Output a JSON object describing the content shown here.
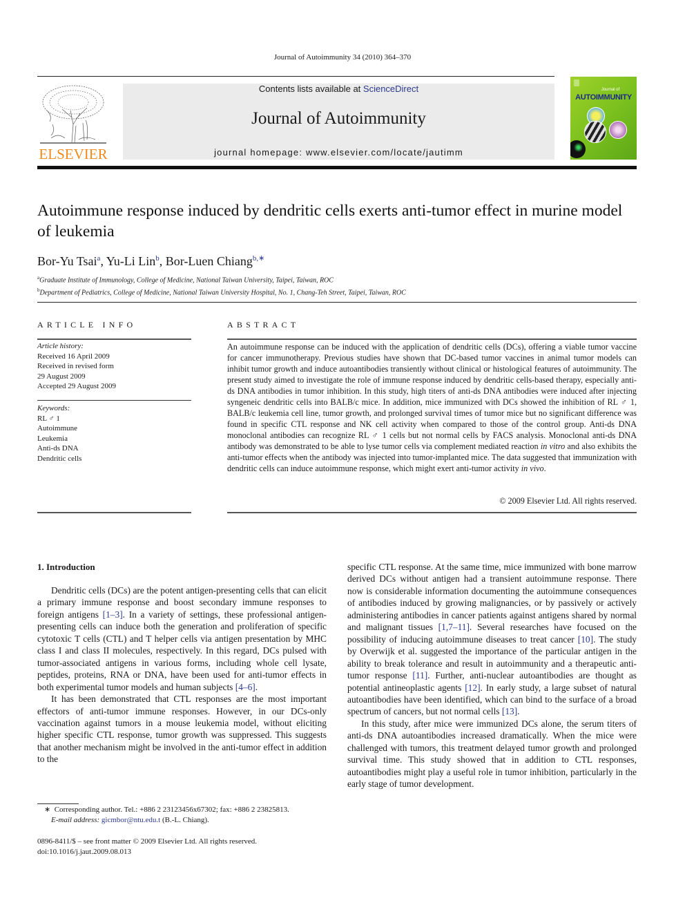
{
  "running_head": "Journal of Autoimmunity 34 (2010) 364–370",
  "publisher": {
    "logo_icon": "elsevier-tree-icon",
    "name": "ELSEVIER",
    "brand_color": "#f08a1c"
  },
  "masthead": {
    "contents_prefix": "Contents lists available at ",
    "contents_link": "ScienceDirect",
    "journal_name": "Journal of Autoimmunity",
    "homepage": "journal homepage: www.elsevier.com/locate/jautimm",
    "background": "#ebebeb"
  },
  "cover": {
    "small_label": "Journal of",
    "title": "AUTOIMMUNITY",
    "color": "#8cc824"
  },
  "article": {
    "title": "Autoimmune response induced by dendritic cells exerts anti-tumor effect in murine model of leukemia",
    "authors": [
      {
        "name": "Bor-Yu Tsai",
        "aff": "a",
        "sep": ", "
      },
      {
        "name": "Yu-Li Lin",
        "aff": "b",
        "sep": ", "
      },
      {
        "name": "Bor-Luen Chiang",
        "aff": "b,∗",
        "sep": ""
      }
    ],
    "affiliations": [
      {
        "key": "a",
        "text": "Graduate Institute of Immunology, College of Medicine, National Taiwan University, Taipei, Taiwan, ROC"
      },
      {
        "key": "b",
        "text": "Department of Pediatrics, College of Medicine, National Taiwan University Hospital, No. 1, Chang-Teh Street, Taipei, Taiwan, ROC"
      }
    ]
  },
  "article_info": {
    "heading": "ARTICLE INFO",
    "history_label": "Article history:",
    "history": [
      "Received 16 April 2009",
      "Received in revised form",
      "29 August 2009",
      "Accepted 29 August 2009"
    ],
    "keywords_label": "Keywords:",
    "keywords": [
      "RL ♂ 1",
      "Autoimmune",
      "Leukemia",
      "Anti-ds DNA",
      "Dendritic cells"
    ]
  },
  "abstract": {
    "heading": "ABSTRACT",
    "text_1": "An autoimmune response can be induced with the application of dendritic cells (DCs), offering a viable tumor vaccine for cancer immunotherapy. Previous studies have shown that DC-based tumor vaccines in animal tumor models can inhibit tumor growth and induce autoantibodies transiently without clinical or histological features of autoimmunity. The present study aimed to investigate the role of immune response induced by dendritic cells-based therapy, especially anti-ds DNA antibodies in tumor inhibition. In this study, high titers of anti-ds DNA antibodies were induced after injecting syngeneic dendritic cells into BALB/c mice. In addition, mice immunized with DCs showed the inhibition of RL ♂ 1, BALB/c leukemia cell line, tumor growth, and prolonged survival times of tumor mice but no significant difference was found in specific CTL response and NK cell activity when compared to those of the control group. Anti-ds DNA monoclonal antibodies can recognize RL ♂ 1 cells but not normal cells by FACS analysis. Monoclonal anti-ds DNA antibody was demonstrated to be able to lyse tumor cells via complement mediated reaction ",
    "italic_1": "in vitro",
    "text_2": " and also exhibits the anti-tumor effects when the antibody was injected into tumor-implanted mice. The data suggested that immunization with dendritic cells can induce autoimmune response, which might exert anti-tumor activity ",
    "italic_2": "in vivo",
    "text_3": ".",
    "copyright": "© 2009 Elsevier Ltd. All rights reserved."
  },
  "introduction": {
    "heading": "1.  Introduction",
    "left": {
      "p1": {
        "a": "Dendritic cells (DCs) are the potent antigen-presenting cells that can elicit a primary immune response and boost secondary immune responses to foreign antigens ",
        "ref1": "[1–3]",
        "b": ". In a variety of settings, these professional antigen-presenting cells can induce both the generation and proliferation of specific cytotoxic T cells (CTL) and T helper cells via antigen presentation by MHC class I and class II molecules, respectively. In this regard, DCs pulsed with tumor-associated antigens in various forms, including whole cell lysate, peptides, proteins, RNA or DNA, have been used for anti-tumor effects in both experimental tumor models and human subjects ",
        "ref2": "[4–6]",
        "c": "."
      },
      "p2": "It has been demonstrated that CTL responses are the most important effectors of anti-tumor immune responses. However, in our DCs-only vaccination against tumors in a mouse leukemia model, without eliciting higher specific CTL response, tumor growth was suppressed. This suggests that another mechanism might be involved in the anti-tumor effect in addition to the"
    },
    "right": {
      "p1": {
        "a": "specific CTL response. At the same time, mice immunized with bone marrow derived DCs without antigen had a transient autoimmune response. There now is considerable information documenting the autoimmune consequences of antibodies induced by growing malignancies, or by passively or actively administering antibodies in cancer patients against antigens shared by normal and malignant tissues ",
        "ref1": "[1,7–11]",
        "b": ". Several researches have focused on the possibility of inducing autoimmune diseases to treat cancer ",
        "ref2": "[10]",
        "c": ". The study by Overwijk et al. suggested the importance of the particular antigen in the ability to break tolerance and result in autoimmunity and a therapeutic anti-tumor response ",
        "ref3": "[11]",
        "d": ". Further, anti-nuclear autoantibodies are thought as potential antineoplastic agents ",
        "ref4": "[12]",
        "e": ". In early study, a large subset of natural autoantibodies have been identified, which can bind to the surface of a broad spectrum of cancers, but not normal cells ",
        "ref5": "[13]",
        "f": "."
      },
      "p2": "In this study, after mice were immunized DCs alone, the serum titers of anti-ds DNA autoantibodies increased dramatically. When the mice were challenged with tumors, this treatment delayed tumor growth and prolonged survival time. This study showed that in addition to CTL responses, autoantibodies might play a useful role in tumor inhibition, particularly in the early stage of tumor development."
    }
  },
  "footnote": {
    "marker": "∗",
    "corresponding": "Corresponding author. Tel.: +886 2 23123456x67302; fax: +886 2 23825813.",
    "email_label": "E-mail address:",
    "email": "gicmbor@ntu.edu.t",
    "email_suffix": " (B.-L. Chiang)."
  },
  "front_matter": {
    "issn_line": "0896-8411/$ – see front matter © 2009 Elsevier Ltd. All rights reserved.",
    "doi": "doi:10.1016/j.jaut.2009.08.013"
  }
}
